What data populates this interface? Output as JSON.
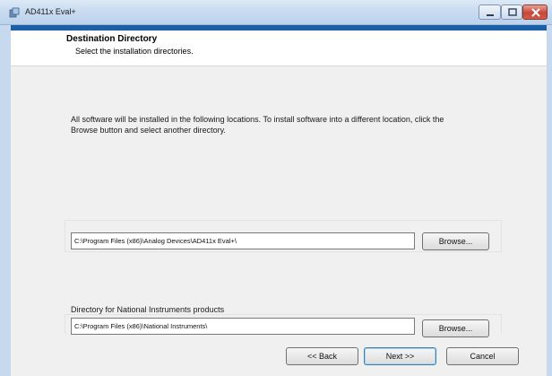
{
  "window": {
    "title": "AD411x Eval+",
    "controls": {
      "minimize": "minimize-icon",
      "maximize": "maximize-icon",
      "close": "close-icon"
    }
  },
  "header": {
    "title": "Destination Directory",
    "subtitle": "Select the installation directories."
  },
  "description": "All software will be installed in the following locations. To install software into a different location, click the Browse button and select another directory.",
  "directories": [
    {
      "value": "C:\\Program Files (x86)\\Analog Devices\\AD411x Eval+\\",
      "browse_label": "Browse..."
    },
    {
      "label": "Directory for National Instruments products",
      "value": "C:\\Program Files (x86)\\National Instruments\\",
      "browse_label": "Browse..."
    }
  ],
  "footer": {
    "back_label": "<< Back",
    "next_label": "Next >>",
    "cancel_label": "Cancel"
  },
  "colors": {
    "accent_strip": "#1a5fa8",
    "close_button": "#c7473a"
  }
}
